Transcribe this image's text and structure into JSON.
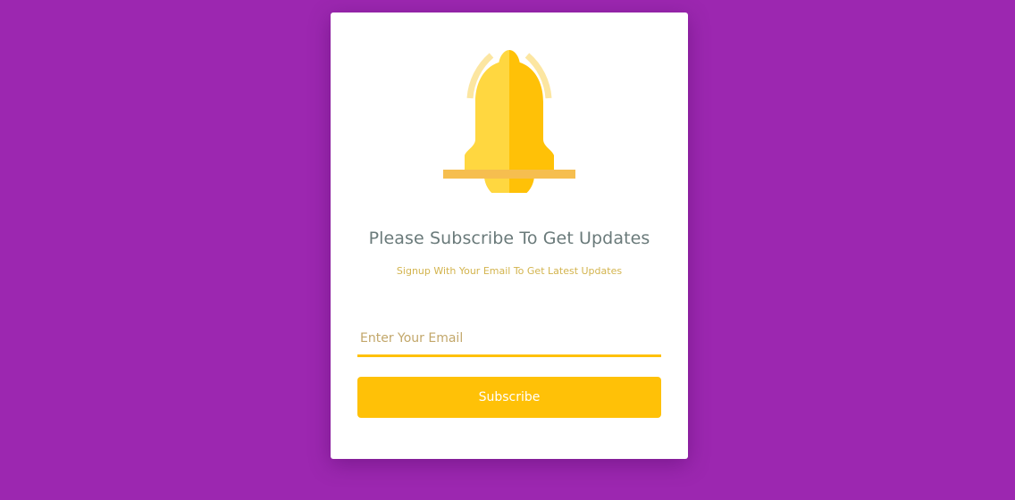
{
  "card": {
    "title": "Please Subscribe To Get Updates",
    "subtitle": "Signup With Your Email To Get Latest Updates",
    "email_placeholder": "Enter Your Email",
    "email_value": "",
    "button_label": "Subscribe"
  },
  "icons": {
    "bell": "bell-icon"
  },
  "colors": {
    "background": "#9c27b0",
    "accent": "#ffc107",
    "bell_light": "#ffd740",
    "card": "#ffffff",
    "title": "#6a7a7a"
  }
}
